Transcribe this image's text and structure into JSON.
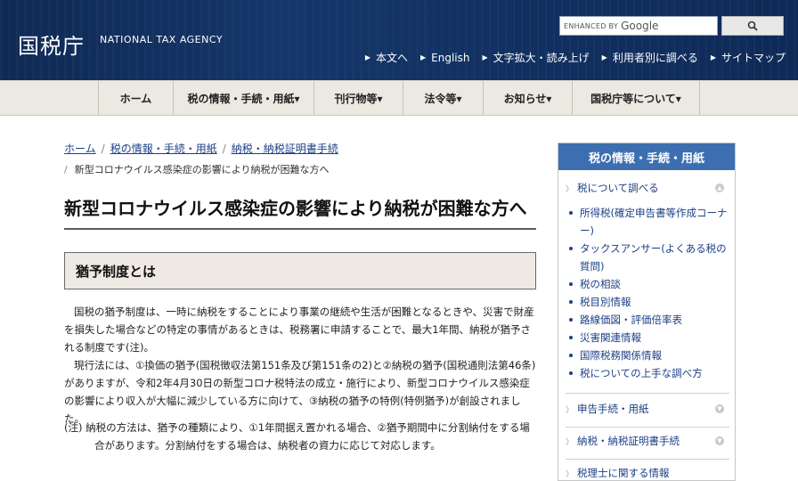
{
  "header": {
    "logo_jp": "国税庁",
    "logo_en": "NATIONAL TAX AGENCY",
    "search_enhanced": "ENHANCED BY",
    "search_google": "Google",
    "toplinks": [
      "本文へ",
      "English",
      "文字拡大・読み上げ",
      "利用者別に調べる",
      "サイトマップ"
    ]
  },
  "nav": {
    "items": [
      "ホーム",
      "税の情報・手続・用紙▾",
      "刊行物等▾",
      "法令等▾",
      "お知らせ▾",
      "国税庁等について▾"
    ]
  },
  "breadcrumb": {
    "links": [
      "ホーム",
      "税の情報・手続・用紙",
      "納税・納税証明書手続"
    ],
    "current": "新型コロナウイルス感染症の影響により納税が困難な方へ"
  },
  "page": {
    "title": "新型コロナウイルス感染症の影響により納税が困難な方へ",
    "section_title": "猶予制度とは",
    "para1": "国税の猶予制度は、一時に納税をすることにより事業の継続や生活が困難となるときや、災害で財産を損失した場合などの特定の事情があるときは、税務署に申請することで、最大1年間、納税が猶予される制度です(注)。",
    "para2": "現行法には、①換価の猶予(国税徴収法第151条及び第151条の2)と②納税の猶予(国税通則法第46条)がありますが、令和2年4月30日の新型コロナ税特法の成立・施行により、新型コロナウイルス感染症の影響により収入が大幅に減少している方に向けて、③納税の猶予の特例(特例猶予)が創設されました。",
    "note": "(注) 納税の方法は、猶予の種類により、①1年間据え置かれる場合、②猶予期間中に分割納付をする場合があります。分割納付をする場合は、納税者の資力に応じて対応します。"
  },
  "sidebar": {
    "title": "税の情報・手続・用紙",
    "cat1": "税について調べる",
    "items": [
      "所得税(確定申告書等作成コーナー)",
      "タックスアンサー(よくある税の質問)",
      "税の相談",
      "税目別情報",
      "路線価図・評価倍率表",
      "災害関連情報",
      "国際税務関係情報",
      "税についての上手な調べ方"
    ],
    "cat2": "申告手続・用紙",
    "cat3": "納税・納税証明書手続",
    "cat4": "税理士に関する情報"
  },
  "colors": {
    "header_bg": "#143669",
    "nav_bg": "#ece8e2",
    "sidebar_head": "#3d6fb0",
    "link": "#1b3f86"
  }
}
